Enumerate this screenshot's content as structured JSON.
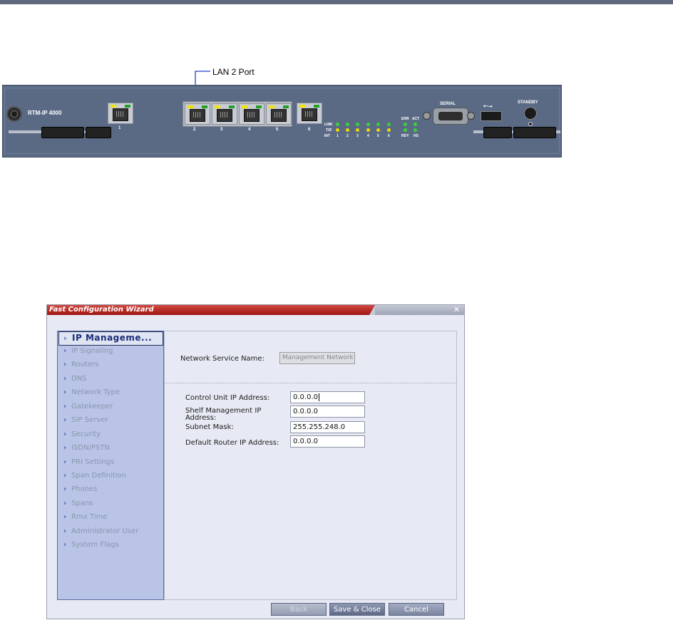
{
  "callout": {
    "label": "LAN 2 Port"
  },
  "hardware": {
    "model_label": "RTM-IP 4000",
    "ports": [
      "1",
      "2",
      "3",
      "4",
      "5",
      "6"
    ],
    "led_row_labels": [
      "LINK",
      "T/R",
      "INT"
    ],
    "led_numbers": [
      "1",
      "2",
      "3",
      "4",
      "5",
      "6"
    ],
    "status_labels_top": [
      "ERR",
      "ACT"
    ],
    "status_labels_bottom": [
      "RDY",
      "HS"
    ],
    "serial_label": "SERIAL",
    "usb_icon": "usb-icon",
    "standby_label": "STANDBY",
    "colors": {
      "panel": "#5a6a85",
      "led_green": "#3ad13a",
      "led_yellow": "#e8d800"
    }
  },
  "dialog": {
    "title": "Fast Configuration Wizard",
    "close_glyph": "✕",
    "nav": {
      "active_index": 0,
      "items": [
        "IP Manageme...",
        "IP Signaling",
        "Routers",
        "DNS",
        "Network Type",
        "Gatekeeper",
        "SIP Server",
        "Security",
        "ISDN/PSTN",
        "PRI Settings",
        "Span Definition",
        "Phones",
        "Spans",
        "Rmx Time",
        "Administrator User",
        "System Flags"
      ]
    },
    "form": {
      "network_service_label": "Network Service Name:",
      "network_service_value": "Management Network",
      "control_unit_label": "Control Unit IP Address:",
      "control_unit_value": "0.0.0.0",
      "shelf_mgmt_label_line1": "Shelf Management IP",
      "shelf_mgmt_label_line2": "Address:",
      "shelf_mgmt_value": "0.0.0.0",
      "subnet_label": "Subnet Mask:",
      "subnet_value": "255.255.248.0",
      "router_label": "Default Router IP Address:",
      "router_value": "0.0.0.0"
    },
    "buttons": {
      "back": "Back",
      "save_close": "Save & Close",
      "cancel": "Cancel"
    },
    "colors": {
      "title_bar": "#b01c16",
      "nav_bg": "#b9c4e6",
      "active_nav_text": "#1a2d78"
    }
  }
}
